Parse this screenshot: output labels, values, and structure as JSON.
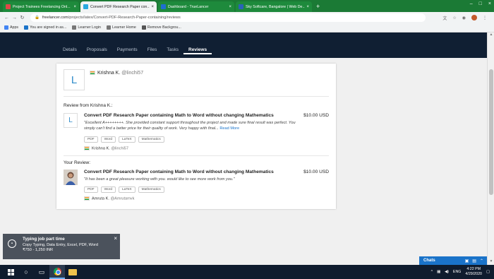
{
  "browser": {
    "tabs": [
      {
        "title": "Project Trainees Freelancing Onl...",
        "fav_color": "#e04848",
        "active": false
      },
      {
        "title": "Convert PDF Research Paper con...",
        "fav_color": "#29a9e0",
        "active": true
      },
      {
        "title": "Dashboard - TrueLancer",
        "fav_color": "#1e6fd0",
        "active": false
      },
      {
        "title": "Sky Softcare, Bangalore | Web De...",
        "fav_color": "#2a62b8",
        "active": false
      }
    ],
    "url_host": "freelancer.com",
    "url_path": "/projects/latex/Convert-PDF-Research-Paper-containing/reviews",
    "bookmarks": [
      {
        "label": "Apps",
        "color": "#4285f4"
      },
      {
        "label": "You are signed in as...",
        "color": "#1a73c9"
      },
      {
        "label": "Learner Login",
        "color": "#777"
      },
      {
        "label": "Learner Home",
        "color": "#777"
      },
      {
        "label": "Remove Backgrou...",
        "color": "#555"
      }
    ]
  },
  "site_nav": {
    "tabs": [
      "Details",
      "Proposals",
      "Payments",
      "Files",
      "Tasks",
      "Reviews"
    ],
    "active": "Reviews"
  },
  "profile": {
    "initial": "L",
    "name": "Krishna K.",
    "handle": "@linchi57"
  },
  "review_from": {
    "heading": "Review from Krishna K.:",
    "avatar_initial": "L",
    "title": "Convert PDF Research Paper containing Math to Word without changing Mathematics",
    "price": "$10.00 USD",
    "text": "\"Excellent A++++++++. She provided constant support throughout the project and made sure final result was perfect. You simply can't find a better price for their quality of work. Very happy with final...",
    "read_more": "Read More",
    "skills": [
      "PDF",
      "Word",
      "LaTeX",
      "Mathematics"
    ],
    "reviewer_name": "Krishna K.",
    "reviewer_handle": "@linchi57"
  },
  "your_review": {
    "heading": "Your Review:",
    "title": "Convert PDF Research Paper containing Math to Word without changing Mathematics",
    "price": "$10.00 USD",
    "text": "\"It has been a great pleasure working with you. would like to see more work from you.\"",
    "skills": [
      "PDF",
      "Word",
      "LaTeX",
      "Mathematics"
    ],
    "reviewer_name": "Amruta K.",
    "reviewer_handle": "@Amrutamvk"
  },
  "toast": {
    "title": "Typing job part time",
    "line1": "Copy Typing, Data Entry, Excel, PDF, Word",
    "line2": "₹750 - 1,250 INR"
  },
  "chat": {
    "label": "Chats"
  },
  "taskbar": {
    "lang": "ENG",
    "time": "4:22 PM",
    "date": "4/29/2020"
  }
}
